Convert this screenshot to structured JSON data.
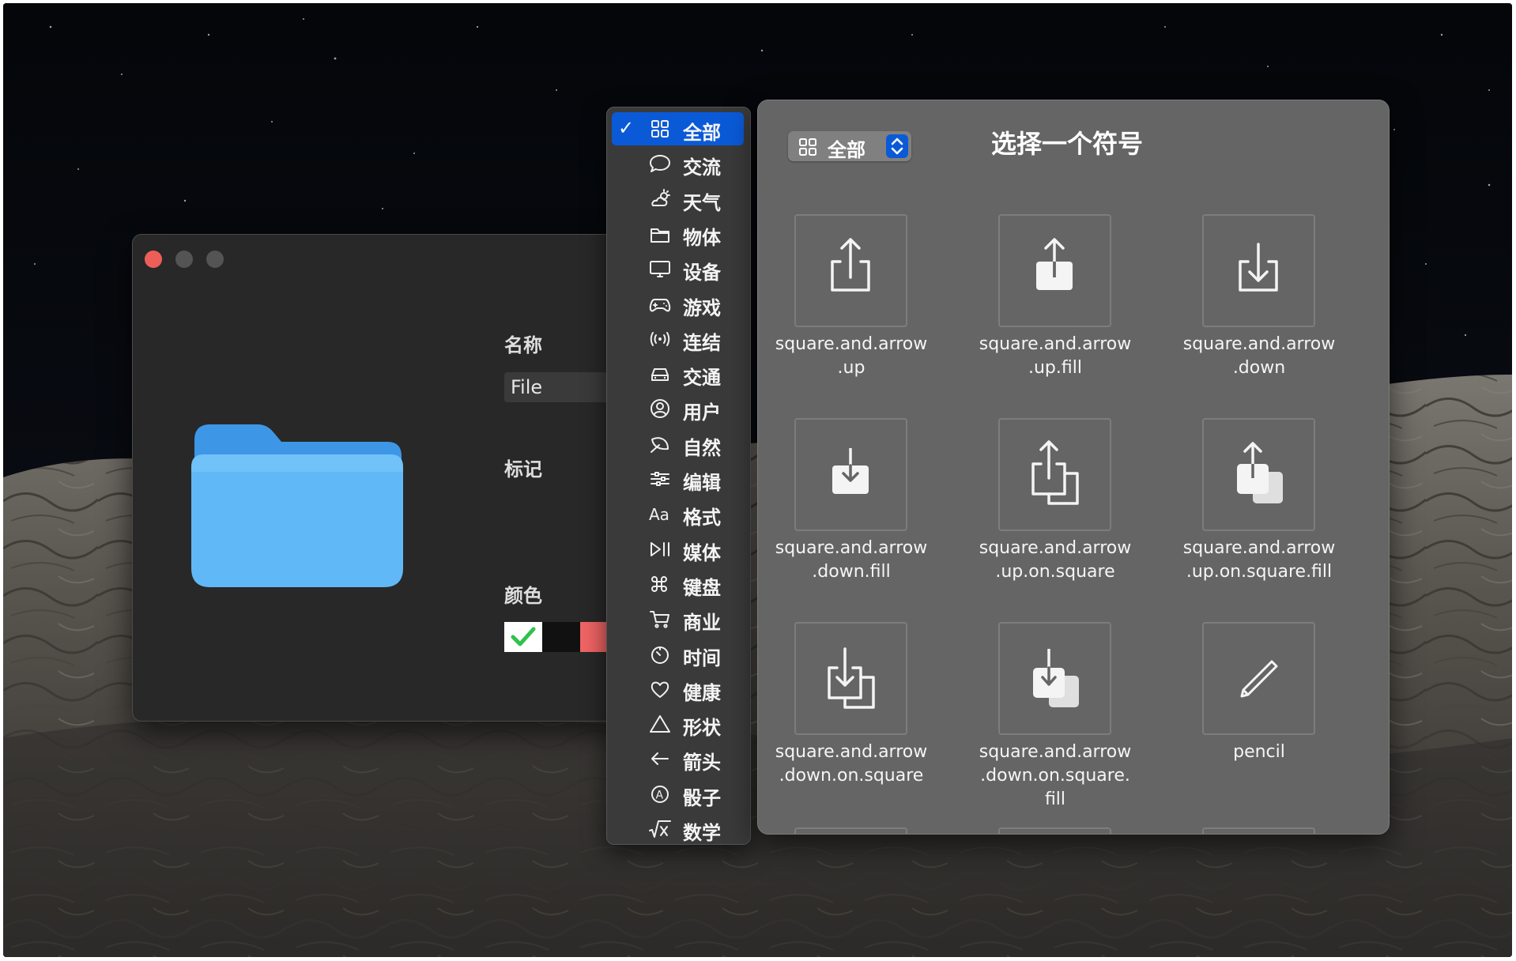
{
  "info_window": {
    "name_label": "名称",
    "name_value": "File",
    "tags_label": "标记",
    "color_label": "颜色",
    "folder_color": "#5ab8f5"
  },
  "category_menu": {
    "selected_index": 0,
    "check_mark": "✓",
    "accent": "#0a5ad8",
    "items": [
      {
        "label": "全部",
        "icon": "square-grid-icon"
      },
      {
        "label": "交流",
        "icon": "speech-bubble-icon"
      },
      {
        "label": "天气",
        "icon": "cloud-sun-icon"
      },
      {
        "label": "物体",
        "icon": "folder-icon"
      },
      {
        "label": "设备",
        "icon": "display-icon"
      },
      {
        "label": "游戏",
        "icon": "gamecontroller-icon"
      },
      {
        "label": "连结",
        "icon": "antenna-waves-icon"
      },
      {
        "label": "交通",
        "icon": "car-icon"
      },
      {
        "label": "用户",
        "icon": "person-circle-icon"
      },
      {
        "label": "自然",
        "icon": "leaf-icon"
      },
      {
        "label": "编辑",
        "icon": "sliders-icon"
      },
      {
        "label": "格式",
        "icon": "textformat-icon"
      },
      {
        "label": "媒体",
        "icon": "playpause-icon"
      },
      {
        "label": "键盘",
        "icon": "command-icon"
      },
      {
        "label": "商业",
        "icon": "cart-icon"
      },
      {
        "label": "时间",
        "icon": "timer-icon"
      },
      {
        "label": "健康",
        "icon": "heart-icon"
      },
      {
        "label": "形状",
        "icon": "triangle-icon"
      },
      {
        "label": "箭头",
        "icon": "arrow-left-icon"
      },
      {
        "label": "骰子",
        "icon": "a-circle-icon"
      },
      {
        "label": "数学",
        "icon": "squareroot-icon"
      }
    ]
  },
  "symbol_panel": {
    "popup_label": "全部",
    "title": "选择一个符号",
    "symbols": [
      {
        "name": "square.and.arrow.up",
        "lines": [
          "square.and.arrow",
          ".up"
        ],
        "icon": "square-and-arrow-up-icon"
      },
      {
        "name": "square.and.arrow.up.fill",
        "lines": [
          "square.and.arrow",
          ".up.fill"
        ],
        "icon": "square-and-arrow-up-fill-icon"
      },
      {
        "name": "square.and.arrow.down",
        "lines": [
          "square.and.arrow",
          ".down"
        ],
        "icon": "square-and-arrow-down-icon"
      },
      {
        "name": "square.and.arrow.down.fill",
        "lines": [
          "square.and.arrow",
          ".down.fill"
        ],
        "icon": "square-and-arrow-down-fill-icon"
      },
      {
        "name": "square.and.arrow.up.on.square",
        "lines": [
          "square.and.arrow",
          ".up.on.square"
        ],
        "icon": "square-and-arrow-up-on-square-icon"
      },
      {
        "name": "square.and.arrow.up.on.square.fill",
        "lines": [
          "square.and.arrow",
          ".up.on.square.fill"
        ],
        "icon": "square-and-arrow-up-on-square-fill-icon"
      },
      {
        "name": "square.and.arrow.down.on.square",
        "lines": [
          "square.and.arrow",
          ".down.on.square"
        ],
        "icon": "square-and-arrow-down-on-square-icon"
      },
      {
        "name": "square.and.arrow.down.on.square.fill",
        "lines": [
          "square.and.arrow",
          ".down.on.square.",
          "fill"
        ],
        "icon": "square-and-arrow-down-on-square-fill-icon"
      },
      {
        "name": "pencil",
        "lines": [
          "pencil"
        ],
        "icon": "pencil-icon"
      }
    ]
  }
}
